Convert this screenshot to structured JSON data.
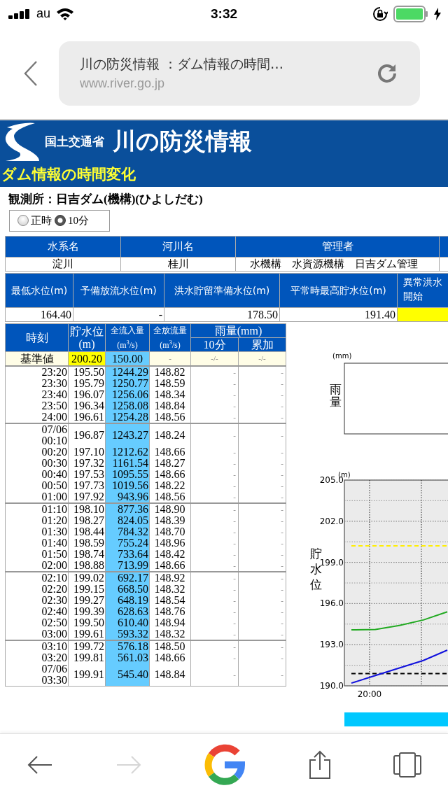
{
  "status_bar": {
    "carrier": "au",
    "time": "3:32"
  },
  "browser": {
    "page_title": "川の防災情報 ：ダム情報の時間…",
    "url": "www.river.go.jp"
  },
  "banner": {
    "ministry": "国土交通省",
    "site_title": "川の防災情報",
    "subtitle": "ダム情報の時間変化"
  },
  "station": "観測所：日吉ダム(機構)(ひよしだむ)",
  "interval_options": [
    {
      "label": "正時",
      "selected": false
    },
    {
      "label": "10分",
      "selected": true
    }
  ],
  "info_table": {
    "columns": [
      "水系名",
      "河川名",
      "管理者"
    ],
    "row": [
      "淀川",
      "桂川",
      "水機構　水資源機構　日吉ダム管理"
    ]
  },
  "levels_table": {
    "columns": [
      [
        "最低水位(m)"
      ],
      [
        "予備放流水位(m)"
      ],
      [
        "洪水貯留準備水位(m)"
      ],
      [
        "平常時最高貯水位(m)"
      ],
      [
        "異常洪水",
        "開始"
      ]
    ],
    "row": [
      "164.40",
      "-",
      "178.50",
      "191.40"
    ]
  },
  "data_table": {
    "headers": {
      "time": "時刻",
      "storage": [
        "貯水位",
        "(m)"
      ],
      "inflow": [
        "全流入量",
        "(m$^{3}$/s)"
      ],
      "outflow": [
        "全放流量",
        "(m$^{3}$/s)"
      ],
      "rain": "雨量(mm)",
      "rain_sub": [
        "10分",
        "累加"
      ]
    },
    "standard_row": {
      "label": "基準値",
      "cells": [
        {
          "text": "200.20",
          "highlighted": true
        },
        {
          "text": "150.00",
          "highlighted": false
        },
        {
          "text": "-",
          "highlighted": false
        },
        {
          "text": "-/-",
          "highlighted": false
        },
        {
          "text": "-/-",
          "highlighted": false
        }
      ]
    },
    "groups": [
      {
        "rows": [
          {
            "time": [
              "23:20"
            ],
            "cells": [
              "195.50",
              "1244.29",
              "148.82",
              "-",
              "-"
            ]
          },
          {
            "time": [
              "23:30"
            ],
            "cells": [
              "195.79",
              "1250.77",
              "148.59",
              "-",
              "-"
            ]
          },
          {
            "time": [
              "23:40"
            ],
            "cells": [
              "196.07",
              "1256.06",
              "148.34",
              "-",
              "-"
            ]
          },
          {
            "time": [
              "23:50"
            ],
            "cells": [
              "196.34",
              "1258.08",
              "148.84",
              "-",
              "-"
            ]
          },
          {
            "time": [
              "24:00"
            ],
            "cells": [
              "196.61",
              "1254.28",
              "148.56",
              "-",
              "-"
            ]
          }
        ]
      },
      {
        "rows": [
          {
            "time": [
              "07/06",
              "00:10"
            ],
            "cells": [
              "196.87",
              "1243.27",
              "148.24",
              "-",
              "-"
            ]
          },
          {
            "time": [
              "00:20"
            ],
            "cells": [
              "197.10",
              "1212.62",
              "148.66",
              "-",
              "-"
            ]
          },
          {
            "time": [
              "00:30"
            ],
            "cells": [
              "197.32",
              "1161.54",
              "148.27",
              "-",
              "-"
            ]
          },
          {
            "time": [
              "00:40"
            ],
            "cells": [
              "197.53",
              "1095.55",
              "148.66",
              "-",
              "-"
            ]
          },
          {
            "time": [
              "00:50"
            ],
            "cells": [
              "197.73",
              "1019.56",
              "148.22",
              "-",
              "-"
            ]
          },
          {
            "time": [
              "01:00"
            ],
            "cells": [
              "197.92",
              "943.96",
              "148.56",
              "-",
              "-"
            ]
          }
        ]
      },
      {
        "rows": [
          {
            "time": [
              "01:10"
            ],
            "cells": [
              "198.10",
              "877.36",
              "148.90",
              "-",
              "-"
            ]
          },
          {
            "time": [
              "01:20"
            ],
            "cells": [
              "198.27",
              "824.05",
              "148.39",
              "-",
              "-"
            ]
          },
          {
            "time": [
              "01:30"
            ],
            "cells": [
              "198.44",
              "784.32",
              "148.70",
              "-",
              "-"
            ]
          },
          {
            "time": [
              "01:40"
            ],
            "cells": [
              "198.59",
              "755.24",
              "148.96",
              "-",
              "-"
            ]
          },
          {
            "time": [
              "01:50"
            ],
            "cells": [
              "198.74",
              "733.64",
              "148.42",
              "-",
              "-"
            ]
          },
          {
            "time": [
              "02:00"
            ],
            "cells": [
              "198.88",
              "713.99",
              "148.66",
              "-",
              "-"
            ]
          }
        ]
      },
      {
        "rows": [
          {
            "time": [
              "02:10"
            ],
            "cells": [
              "199.02",
              "692.17",
              "148.92",
              "-",
              "-"
            ]
          },
          {
            "time": [
              "02:20"
            ],
            "cells": [
              "199.15",
              "668.50",
              "148.32",
              "-",
              "-"
            ]
          },
          {
            "time": [
              "02:30"
            ],
            "cells": [
              "199.27",
              "648.19",
              "148.54",
              "-",
              "-"
            ]
          },
          {
            "time": [
              "02:40"
            ],
            "cells": [
              "199.39",
              "628.63",
              "148.76",
              "-",
              "-"
            ]
          },
          {
            "time": [
              "02:50"
            ],
            "cells": [
              "199.50",
              "610.40",
              "148.94",
              "-",
              "-"
            ]
          },
          {
            "time": [
              "03:00"
            ],
            "cells": [
              "199.61",
              "593.32",
              "148.32",
              "-",
              "-"
            ]
          }
        ]
      },
      {
        "rows": [
          {
            "time": [
              "03:10"
            ],
            "cells": [
              "199.72",
              "576.18",
              "148.50",
              "-",
              "-"
            ]
          },
          {
            "time": [
              "03:20"
            ],
            "cells": [
              "199.81",
              "561.03",
              "148.66",
              "-",
              "-"
            ]
          },
          {
            "time": [
              "07/06",
              "03:30"
            ],
            "cells": [
              "199.91",
              "545.40",
              "148.84",
              "-",
              "-"
            ]
          }
        ]
      }
    ]
  },
  "rain_chart": {
    "unit": "(mm)",
    "label": "雨量"
  },
  "level_chart": {
    "unit": "(m)",
    "chart_data": {
      "type": "line",
      "ylabel": "貯水位",
      "ylim": [
        190,
        205
      ],
      "grid": true,
      "annotations": [
        "20:00"
      ],
      "yticks": [
        {
          "value": 205,
          "label": "205.0"
        },
        {
          "value": 202,
          "label": "202.0"
        },
        {
          "value": 199,
          "label": "199.0"
        },
        {
          "value": 196,
          "label": "196.0"
        },
        {
          "value": 193,
          "label": "193.0"
        },
        {
          "value": 190,
          "label": "190.0"
        }
      ],
      "series": [
        {
          "color": "#ffee00",
          "line_style": "dashed",
          "values": [
            200.2,
            200.2,
            200.2,
            200.2,
            200.2
          ]
        },
        {
          "color": "#000000",
          "line_style": "dashed",
          "values": [
            190.9,
            190.9,
            190.9,
            190.9,
            190.9
          ]
        },
        {
          "color": "#22aa22",
          "line_style": "solid",
          "values": [
            194.08,
            194.1,
            194.4,
            194.8,
            195.4
          ]
        },
        {
          "color": "#1010dd",
          "line_style": "solid",
          "values": [
            190.2,
            190.75,
            191.3,
            191.85,
            192.6
          ]
        }
      ]
    }
  },
  "toolbar": {
    "forward_disabled": true
  }
}
